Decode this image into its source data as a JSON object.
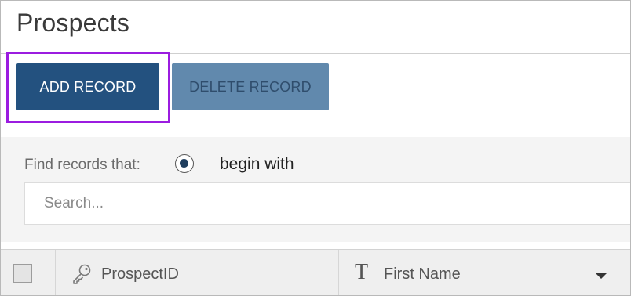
{
  "page": {
    "title": "Prospects"
  },
  "toolbar": {
    "add_label": "ADD RECORD",
    "delete_label": "DELETE RECORD"
  },
  "filter": {
    "label": "Find records that:",
    "option_label": "begin with",
    "option_selected": true,
    "search_placeholder": "Search...",
    "search_value": ""
  },
  "table": {
    "columns": [
      {
        "label": "ProspectID",
        "icon": "key-icon"
      },
      {
        "label": "First Name",
        "icon": "text-type-icon",
        "sort_dropdown": true
      }
    ]
  },
  "colors": {
    "primary": "#23517f",
    "disabled": "#6189ad",
    "highlight": "#9b1ce0"
  }
}
